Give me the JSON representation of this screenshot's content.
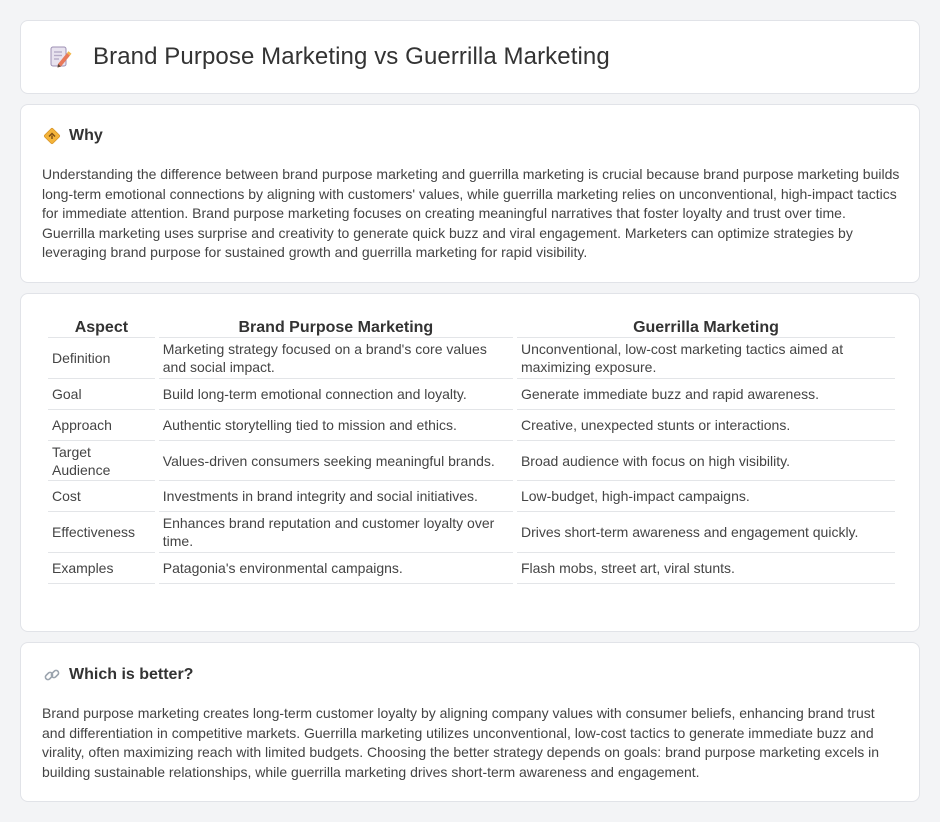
{
  "header": {
    "title": "Brand Purpose Marketing vs Guerrilla Marketing",
    "icon": "document-pencil-icon"
  },
  "why": {
    "icon": "diamond-sign-icon",
    "title": "Why",
    "body": "Understanding the difference between brand purpose marketing and guerrilla marketing is crucial because brand purpose marketing builds long-term emotional connections by aligning with customers' values, while guerrilla marketing relies on unconventional, high-impact tactics for immediate attention. Brand purpose marketing focuses on creating meaningful narratives that foster loyalty and trust over time. Guerrilla marketing uses surprise and creativity to generate quick buzz and viral engagement. Marketers can optimize strategies by leveraging brand purpose for sustained growth and guerrilla marketing for rapid visibility."
  },
  "comparison": {
    "headers": [
      "Aspect",
      "Brand Purpose Marketing",
      "Guerrilla Marketing"
    ],
    "rows": [
      [
        "Definition",
        "Marketing strategy focused on a brand's core values and social impact.",
        "Unconventional, low-cost marketing tactics aimed at maximizing exposure."
      ],
      [
        "Goal",
        "Build long-term emotional connection and loyalty.",
        "Generate immediate buzz and rapid awareness."
      ],
      [
        "Approach",
        "Authentic storytelling tied to mission and ethics.",
        "Creative, unexpected stunts or interactions."
      ],
      [
        "Target Audience",
        "Values-driven consumers seeking meaningful brands.",
        "Broad audience with focus on high visibility."
      ],
      [
        "Cost",
        "Investments in brand integrity and social initiatives.",
        "Low-budget, high-impact campaigns."
      ],
      [
        "Effectiveness",
        "Enhances brand reputation and customer loyalty over time.",
        "Drives short-term awareness and engagement quickly."
      ],
      [
        "Examples",
        "Patagonia's environmental campaigns.",
        "Flash mobs, street art, viral stunts."
      ]
    ]
  },
  "better": {
    "icon": "link-icon",
    "title": "Which is better?",
    "body": "Brand purpose marketing creates long-term customer loyalty by aligning company values with consumer beliefs, enhancing brand trust and differentiation in competitive markets. Guerrilla marketing utilizes unconventional, low-cost tactics to generate immediate buzz and virality, often maximizing reach with limited budgets. Choosing the better strategy depends on goals: brand purpose marketing excels in building sustainable relationships, while guerrilla marketing drives short-term awareness and engagement."
  }
}
